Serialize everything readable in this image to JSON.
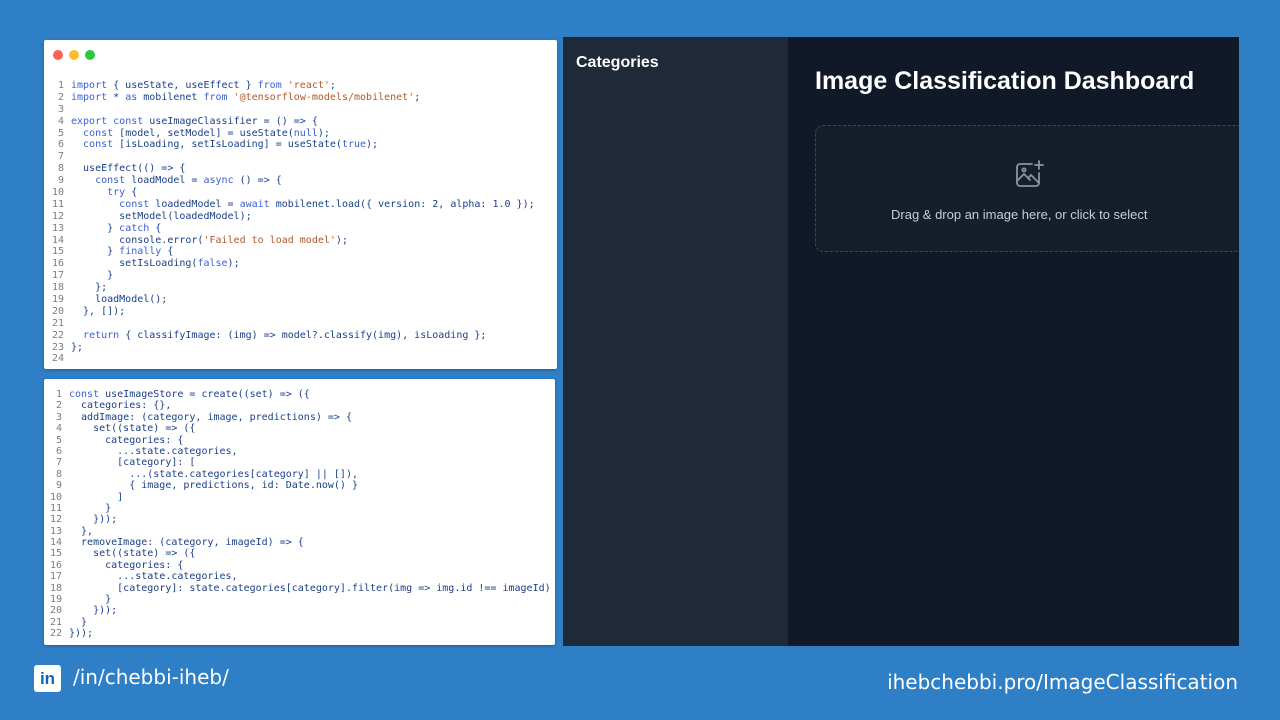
{
  "colors": {
    "background": "#2e7fc6",
    "keyword": "#3b5fd6",
    "string": "#b05a2b",
    "line_number": "#7c7c7c",
    "app_background": "#111827",
    "sidebar_background": "#1f2937"
  },
  "window_controls": [
    {
      "name": "close",
      "color": "#ff5f57"
    },
    {
      "name": "minimize",
      "color": "#febc2e"
    },
    {
      "name": "maximize",
      "color": "#28c840"
    }
  ],
  "code_top": {
    "lines": [
      "import { useState, useEffect } from 'react';",
      "import * as mobilenet from '@tensorflow-models/mobilenet';",
      "",
      "export const useImageClassifier = () => {",
      "  const [model, setModel] = useState(null);",
      "  const [isLoading, setIsLoading] = useState(true);",
      "",
      "  useEffect(() => {",
      "    const loadModel = async () => {",
      "      try {",
      "        const loadedModel = await mobilenet.load({ version: 2, alpha: 1.0 });",
      "        setModel(loadedModel);",
      "      } catch {",
      "        console.error('Failed to load model');",
      "      } finally {",
      "        setIsLoading(false);",
      "      }",
      "    };",
      "    loadModel();",
      "  }, []);",
      "",
      "  return { classifyImage: (img) => model?.classify(img), isLoading };",
      "};",
      ""
    ]
  },
  "code_bottom": {
    "lines": [
      "const useImageStore = create((set) => ({",
      "  categories: {},",
      "  addImage: (category, image, predictions) => {",
      "    set((state) => ({",
      "      categories: {",
      "        ...state.categories,",
      "        [category]: [",
      "          ...(state.categories[category] || []),",
      "          { image, predictions, id: Date.now() }",
      "        ]",
      "      }",
      "    }));",
      "  },",
      "  removeImage: (category, imageId) => {",
      "    set((state) => ({",
      "      categories: {",
      "        ...state.categories,",
      "        [category]: state.categories[category].filter(img => img.id !== imageId)",
      "      }",
      "    }));",
      "  }",
      "}));"
    ]
  },
  "app": {
    "sidebar_title": "Categories",
    "main_title": "Image Classification Dashboard",
    "dropzone_text": "Drag & drop an image here, or click to select",
    "dropzone_icon": "image-add-icon"
  },
  "footer": {
    "linkedin_badge": "in",
    "linkedin_handle": "/in/chebbi-iheb/",
    "site_link": "ihebchebbi.pro/ImageClassification"
  }
}
